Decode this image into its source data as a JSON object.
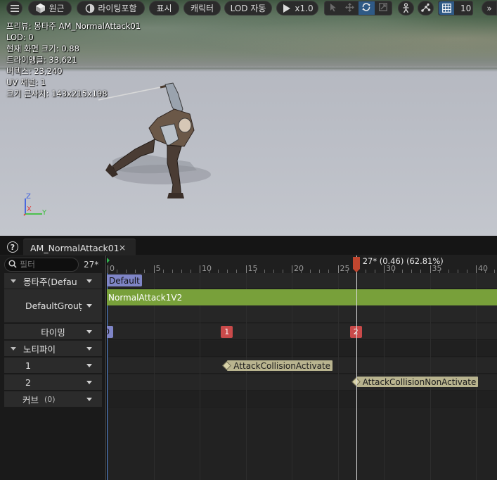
{
  "toolbar": {
    "perspective_label": "원근",
    "lighting_label": "라이팅포함",
    "show_label": "표시",
    "character_label": "캐릭터",
    "lod_label": "LOD 자동",
    "play_rate_label": "x1.0",
    "grid_snap_value": "10"
  },
  "stats": {
    "preview": "프리뷰: 몽타주 AM_NormalAttack01",
    "lod": "LOD: 0",
    "screen_size": "현재 화면 크기: 0.88",
    "triangles": "트라이앵글: 33,621",
    "vertices": "버텍스: 23,240",
    "uv_channels": "UV 채널: 1",
    "approx_size": "크기 근사치: 143x215x198"
  },
  "axis": {
    "z": "Z",
    "x": "X",
    "y": "Y"
  },
  "tab": {
    "title": "AM_NormalAttack01",
    "close": "×"
  },
  "tree": {
    "search_placeholder": "필터",
    "frame_count": "27*",
    "montage_label": "몽타주(Defau",
    "group_label": "DefaultGrouț",
    "timing_label": "타이밍",
    "notify_label": "노티파이",
    "notify_track_1": "1",
    "notify_track_2": "2",
    "curve_label": "커브",
    "curve_count": "(0)"
  },
  "timeline": {
    "ticks": [
      "0",
      "5",
      "10",
      "15",
      "20",
      "25",
      "30",
      "35",
      "40"
    ],
    "playhead_label": "27* (0.46) (62.81%)",
    "playhead_frame": 27,
    "slot_chip": "Default",
    "segment": "NormalAttack1V2",
    "section_start": "0",
    "section_1": "1",
    "section_2": "2",
    "notify_1": "AttackCollisionActivate",
    "notify_2": "AttackCollisionNonActivate",
    "section_1_frame": 13,
    "section_2_frame": 27,
    "notify_1_frame": 13,
    "notify_2_frame": 27
  },
  "colors": {
    "segment": "#78a03a",
    "section_marker": "#c94a4a",
    "notify": "#b9b48f",
    "slot": "#7f85c7",
    "playhead": "#c0462f",
    "active_toggle": "#2f5a86"
  }
}
